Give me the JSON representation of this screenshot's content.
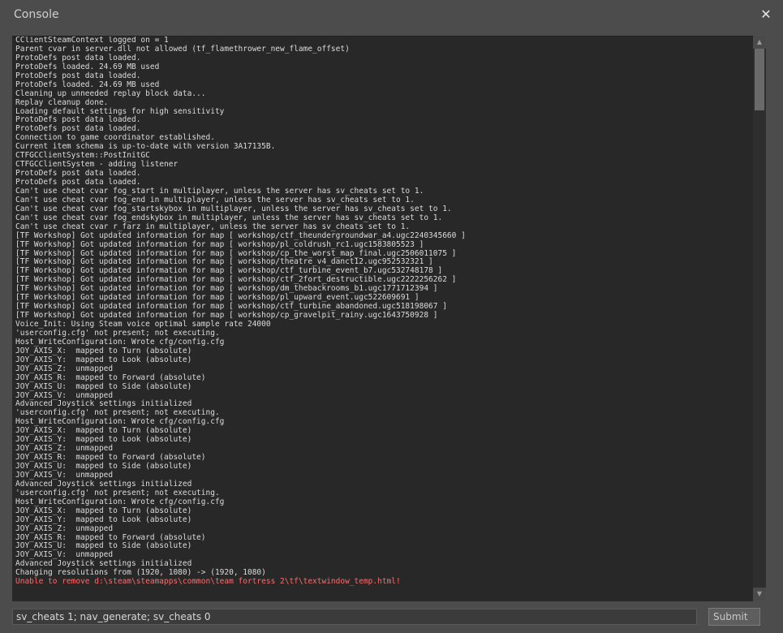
{
  "window": {
    "title": "Console",
    "close_glyph": "✕"
  },
  "console": {
    "lines": [
      {
        "text": "CClientSteamContext logged on = 1"
      },
      {
        "text": "Parent cvar in server.dll not allowed (tf_flamethrower_new_flame_offset)"
      },
      {
        "text": "ProtoDefs post data loaded."
      },
      {
        "text": "ProtoDefs loaded. 24.69 MB used"
      },
      {
        "text": "ProtoDefs post data loaded."
      },
      {
        "text": "ProtoDefs loaded. 24.69 MB used"
      },
      {
        "text": "Cleaning up unneeded replay block data..."
      },
      {
        "text": "Replay cleanup done."
      },
      {
        "text": "Loading default settings for high sensitivity"
      },
      {
        "text": "ProtoDefs post data loaded."
      },
      {
        "text": "ProtoDefs post data loaded."
      },
      {
        "text": "Connection to game coordinator established."
      },
      {
        "text": "Current item schema is up-to-date with version 3A17135B."
      },
      {
        "text": "CTFGCClientSystem::PostInitGC"
      },
      {
        "text": "CTFGCClientSystem - adding listener"
      },
      {
        "text": "ProtoDefs post data loaded."
      },
      {
        "text": "ProtoDefs post data loaded."
      },
      {
        "text": "Can't use cheat cvar fog_start in multiplayer, unless the server has sv_cheats set to 1."
      },
      {
        "text": "Can't use cheat cvar fog_end in multiplayer, unless the server has sv_cheats set to 1."
      },
      {
        "text": "Can't use cheat cvar fog_startskybox in multiplayer, unless the server has sv_cheats set to 1."
      },
      {
        "text": "Can't use cheat cvar fog_endskybox in multiplayer, unless the server has sv_cheats set to 1."
      },
      {
        "text": "Can't use cheat cvar r_farz in multiplayer, unless the server has sv_cheats set to 1."
      },
      {
        "text": "[TF Workshop] Got updated information for map [ workshop/ctf_theundergroundwar_a4.ugc2240345660 ]"
      },
      {
        "text": "[TF Workshop] Got updated information for map [ workshop/pl_coldrush_rc1.ugc1583805523 ]"
      },
      {
        "text": "[TF Workshop] Got updated information for map [ workshop/cp_the_worst_map_final.ugc2506011075 ]"
      },
      {
        "text": "[TF Workshop] Got updated information for map [ workshop/theatre_v4_danct12.ugc952532321 ]"
      },
      {
        "text": "[TF Workshop] Got updated information for map [ workshop/ctf_turbine_event_b7.ugc532748178 ]"
      },
      {
        "text": "[TF Workshop] Got updated information for map [ workshop/ctf_2fort_destructible.ugc2222256262 ]"
      },
      {
        "text": "[TF Workshop] Got updated information for map [ workshop/dm_thebackrooms_b1.ugc1771712394 ]"
      },
      {
        "text": "[TF Workshop] Got updated information for map [ workshop/pl_upward_event.ugc522609691 ]"
      },
      {
        "text": "[TF Workshop] Got updated information for map [ workshop/ctf_turbine_abandoned.ugc518198067 ]"
      },
      {
        "text": "[TF Workshop] Got updated information for map [ workshop/cp_gravelpit_rainy.ugc1643750928 ]"
      },
      {
        "text": "Voice_Init: Using Steam voice optimal sample rate 24000"
      },
      {
        "text": "'userconfig.cfg' not present; not executing."
      },
      {
        "text": "Host_WriteConfiguration: Wrote cfg/config.cfg"
      },
      {
        "text": "JOY_AXIS_X:  mapped to Turn (absolute)"
      },
      {
        "text": "JOY_AXIS_Y:  mapped to Look (absolute)"
      },
      {
        "text": "JOY_AXIS_Z:  unmapped"
      },
      {
        "text": "JOY_AXIS_R:  mapped to Forward (absolute)"
      },
      {
        "text": "JOY_AXIS_U:  mapped to Side (absolute)"
      },
      {
        "text": "JOY_AXIS_V:  unmapped"
      },
      {
        "text": "Advanced Joystick settings initialized"
      },
      {
        "text": "'userconfig.cfg' not present; not executing."
      },
      {
        "text": "Host_WriteConfiguration: Wrote cfg/config.cfg"
      },
      {
        "text": "JOY_AXIS_X:  mapped to Turn (absolute)"
      },
      {
        "text": "JOY_AXIS_Y:  mapped to Look (absolute)"
      },
      {
        "text": "JOY_AXIS_Z:  unmapped"
      },
      {
        "text": "JOY_AXIS_R:  mapped to Forward (absolute)"
      },
      {
        "text": "JOY_AXIS_U:  mapped to Side (absolute)"
      },
      {
        "text": "JOY_AXIS_V:  unmapped"
      },
      {
        "text": "Advanced Joystick settings initialized"
      },
      {
        "text": "'userconfig.cfg' not present; not executing."
      },
      {
        "text": "Host_WriteConfiguration: Wrote cfg/config.cfg"
      },
      {
        "text": "JOY_AXIS_X:  mapped to Turn (absolute)"
      },
      {
        "text": "JOY_AXIS_Y:  mapped to Look (absolute)"
      },
      {
        "text": "JOY_AXIS_Z:  unmapped"
      },
      {
        "text": "JOY_AXIS_R:  mapped to Forward (absolute)"
      },
      {
        "text": "JOY_AXIS_U:  mapped to Side (absolute)"
      },
      {
        "text": "JOY_AXIS_V:  unmapped"
      },
      {
        "text": "Advanced Joystick settings initialized"
      },
      {
        "text": "Changing resolutions from (1920, 1080) -> (1920, 1080)"
      },
      {
        "text": "Unable to remove d:\\steam\\steamapps\\common\\team fortress 2\\tf\\textwindow_temp.html!",
        "error": true
      }
    ]
  },
  "input": {
    "value": "sv_cheats 1; nav_generate; sv_cheats 0"
  },
  "submit": {
    "label": "Submit"
  },
  "scrollbar": {
    "up_glyph": "▲",
    "down_glyph": "▼"
  },
  "colors": {
    "background": "#4c4c4c",
    "log_background": "#282828",
    "log_text": "#dcdcdc",
    "error_text": "#ff6b6b"
  }
}
